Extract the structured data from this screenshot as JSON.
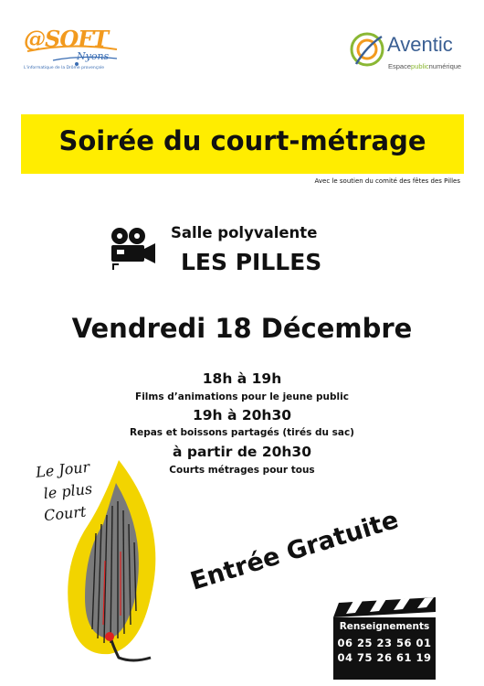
{
  "logos": {
    "asoft_word": "@SOFT",
    "asoft_sub": "Nyons",
    "asoft_tagline": "L'informatique de la Drôme provençale",
    "aventic_word": "Aventic",
    "aventic_tag_a": "Espace",
    "aventic_tag_b": "public",
    "aventic_tag_c": "numérique"
  },
  "banner": {
    "title": "Soirée du court-métrage"
  },
  "support": "Avec le soutien du comité des fêtes des Pilles",
  "venue": {
    "line1": "Salle polyvalente",
    "line2": "LES PILLES"
  },
  "date": "Vendredi 18 Décembre",
  "schedule": [
    {
      "time": "18h à 19h",
      "desc": "Films d’animations pour le jeune public"
    },
    {
      "time": "19h à 20h30",
      "desc": "Repas et boissons partagés (tirés du sac)"
    },
    {
      "time": "à partir de 20h30",
      "desc": "Courts métrages pour tous"
    }
  ],
  "artwork_text": [
    "Le Jour",
    "le plus",
    "Court"
  ],
  "entree": "Entrée Gratuite",
  "contact": {
    "title": "Renseignements",
    "phones": [
      "06 25 23 56 01",
      "04 75 26 61 19"
    ]
  },
  "colors": {
    "banner": "#ffed00",
    "asoft_orange": "#f29a1e",
    "aventic_blue": "#3a5f93",
    "aventic_green": "#8ab733"
  },
  "icons": [
    "movie-camera-icon",
    "match-flame-artwork",
    "clapperboard-icon"
  ]
}
